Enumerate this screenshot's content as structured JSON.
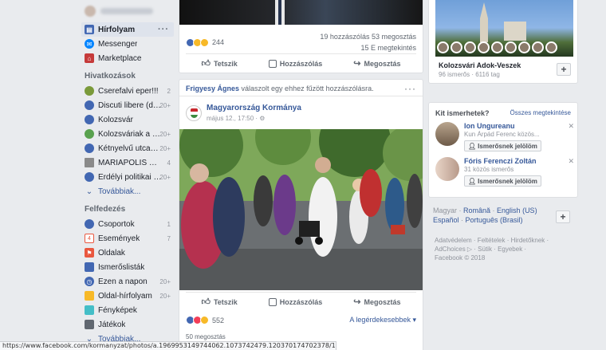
{
  "sidebar": {
    "items": [
      {
        "label": "Hírfolyam",
        "color": "#4267b2",
        "glyph": "▤"
      },
      {
        "label": "Messenger",
        "color": "#0084ff",
        "glyph": "✉"
      },
      {
        "label": "Marketplace",
        "color": "#c53a3a",
        "glyph": "⌂"
      }
    ],
    "shortcuts_title": "Hivatkozások",
    "shortcuts": [
      {
        "label": "Cserefalvi eper!!!",
        "count": "2",
        "color": "#7a9a3a"
      },
      {
        "label": "Discuti libere (dar ...",
        "count": "20+",
        "color": "#4267b2"
      },
      {
        "label": "Kolozsvár",
        "count": "",
        "color": "#4267b2"
      },
      {
        "label": "Kolozsváriak a nag...",
        "count": "20+",
        "color": "#58a14e"
      },
      {
        "label": "Kétnyelvű utcanévt...",
        "count": "20+",
        "color": "#4267b2"
      },
      {
        "label": "MARIAPOLIS RO...",
        "count": "4",
        "color": "#8a8a8a"
      },
      {
        "label": "Erdélyi politikai bes...",
        "count": "20+",
        "color": "#4267b2"
      }
    ],
    "shortcuts_more": "Továbbiak...",
    "explore_title": "Felfedezés",
    "explore": [
      {
        "label": "Csoportok",
        "count": "1",
        "color": "#4267b2"
      },
      {
        "label": "Események",
        "count": "7",
        "color": "#e9573f"
      },
      {
        "label": "Oldalak",
        "count": "",
        "color": "#e9573f"
      },
      {
        "label": "Ismerőslisták",
        "count": "",
        "color": "#4267b2"
      },
      {
        "label": "Ezen a napon",
        "count": "20+",
        "color": "#4267b2"
      },
      {
        "label": "Oldal-hírfolyam",
        "count": "20+",
        "color": "#f7b928"
      },
      {
        "label": "Fényképek",
        "count": "",
        "color": "#44bec7"
      },
      {
        "label": "Játékok",
        "count": "",
        "color": "#606770"
      }
    ],
    "explore_more": "Továbbiak..."
  },
  "post1": {
    "reactions": "244",
    "comments": "19 hozzászólás",
    "shares": "53 megosztás",
    "views": "15 E megtekintés",
    "like": "Tetszik",
    "comment": "Hozzászólás",
    "share": "Megosztás"
  },
  "post2": {
    "sharer": "Frigyesy Ágnes",
    "share_text": " válaszolt egy ehhez fűzött hozzászólásra.",
    "page_name": "Magyarország Kormánya",
    "date": "május 12., 17:50 · ⚙",
    "reactions": "552",
    "sort": "A legérdekesebbek ▾",
    "share_count": "50 megosztás",
    "like": "Tetszik",
    "comment": "Hozzászólás",
    "share": "Megosztás"
  },
  "group": {
    "name": "Kolozsvári Adok-Veszek",
    "meta": "96 ismerős · 6116 tag",
    "plus": "+"
  },
  "pymk": {
    "title": "Kit ismerhetek?",
    "see_all": "Összes megtekintése",
    "people": [
      {
        "name": "Ion Ungureanu",
        "sub": "Kun Árpád Ferenc közös...",
        "button": "Ismerősnek jelölöm"
      },
      {
        "name": "Fóris Ferenczi Zoltán",
        "sub": "31 közös ismerős",
        "button": "Ismerősnek jelölöm"
      }
    ]
  },
  "languages": {
    "current": "Magyar",
    "others": [
      "Română",
      "English (US)",
      "Español",
      "Português (Brasil)"
    ],
    "plus": "+"
  },
  "footer": {
    "line1": "Adatvédelem · Feltételek · Hirdetőknek ·",
    "line2": "AdChoices ▷ · Sütik · Egyebek ·",
    "line3": "Facebook © 2018"
  },
  "status_url": "https://www.facebook.com/kormanyzat/photos/a.1969953149744062.1073742479.120370174702378/1969953319744045/?type=3"
}
